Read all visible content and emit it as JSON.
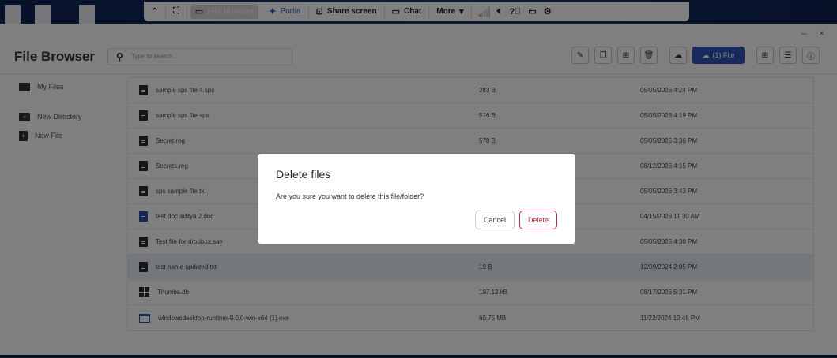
{
  "toolbar": {
    "file_browser": "File browser",
    "portia": "Portia",
    "share_screen": "Share screen",
    "chat": "Chat",
    "more": "More"
  },
  "app": {
    "title": "File Browser",
    "search_placeholder": "Type to search...",
    "window_controls": "– ×",
    "upload_label": "(1) File"
  },
  "sidebar": {
    "items": [
      {
        "label": "My Files"
      },
      {
        "label": "New Directory"
      },
      {
        "label": "New File"
      }
    ]
  },
  "files": [
    {
      "name": "sample sps file 4.sps",
      "size": "283 B",
      "modified": "05/05/2026 4:24 PM"
    },
    {
      "name": "sample sps file.sps",
      "size": "516 B",
      "modified": "05/05/2026 4:19 PM"
    },
    {
      "name": "Secret.reg",
      "size": "578 B",
      "modified": "05/05/2026 3:36 PM"
    },
    {
      "name": "Secrets.reg",
      "size": "",
      "modified": "08/12/2026 4:15 PM"
    },
    {
      "name": "sps sample file.txt",
      "size": "",
      "modified": "05/05/2026 3:43 PM"
    },
    {
      "name": "test doc aditya 2.doc",
      "size": "",
      "modified": "04/15/2026 11:30 AM"
    },
    {
      "name": "Test file for dropbox.sav",
      "size": "",
      "modified": "05/05/2026 4:30 PM"
    },
    {
      "name": "test name updated.txt",
      "size": "19 B",
      "modified": "12/09/2024 2:05 PM"
    },
    {
      "name": "Thumbs.db",
      "size": "197.12 kB",
      "modified": "08/17/2026 5:31 PM"
    },
    {
      "name": "windowsdesktop-runtime-9.0.0-win-x64 (1).exe",
      "size": "60.75 MB",
      "modified": "11/22/2024 12:48 PM"
    }
  ],
  "dialog": {
    "title": "Delete files",
    "message": "Are you sure you want to delete this file/folder?",
    "cancel": "Cancel",
    "delete": "Delete"
  }
}
